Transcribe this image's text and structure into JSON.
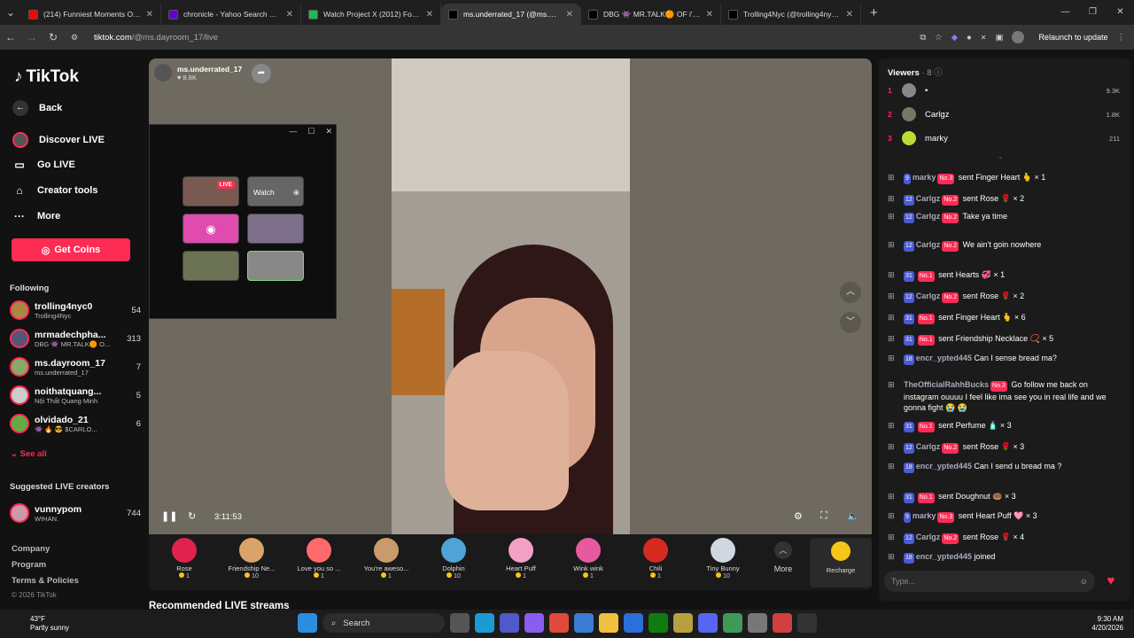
{
  "tabs": [
    {
      "title": "(214) Funniest Moments On Po...",
      "color": "#ff0000"
    },
    {
      "title": "chronicle - Yahoo Search Results",
      "color": "#6001d2"
    },
    {
      "title": "Watch Project X (2012) For Free",
      "color": "#1db954"
    },
    {
      "title": "ms.underrated_17 (@ms.da...",
      "color": "#000000",
      "active": true
    },
    {
      "title": "DBG 👾 MR.TALK🟠 OF i'y Di",
      "color": "#000000"
    },
    {
      "title": "Trolling4Nyc (@trolling4nyc...",
      "color": "#000000"
    }
  ],
  "address": {
    "host": "tiktok.com",
    "path": "/@ms.dayroom_17/live",
    "relaunch": "Relaunch to update"
  },
  "sidebar": {
    "brand": "TikTok",
    "back": "Back",
    "discover": "Discover LIVE",
    "golive": "Go LIVE",
    "creator": "Creator tools",
    "more": "More",
    "getcoins": "Get Coins",
    "following_title": "Following",
    "following": [
      {
        "name": "trolling4nyc0",
        "sub": "Trolling4Nyc",
        "count": "54"
      },
      {
        "name": "mrmadechpha...",
        "sub": "DBG 👾 MR.TALK🟠 O...",
        "count": "313"
      },
      {
        "name": "ms.dayroom_17",
        "sub": "ms.underrated_17",
        "count": "7"
      },
      {
        "name": "noithatquang...",
        "sub": "Nội Thất Quang Minh",
        "count": "5"
      },
      {
        "name": "olvidado_21",
        "sub": "👾 🔥 😎 $CARLO...",
        "count": "6"
      }
    ],
    "seeall": "See all",
    "suggested_title": "Suggested LIVE creators",
    "suggested": {
      "name": "vunnypom",
      "sub": "WIHAN.",
      "count": "744"
    },
    "footer": [
      "Company",
      "Program",
      "Terms & Policies"
    ],
    "copyright": "© 2026 TikTok"
  },
  "player": {
    "streamer": "ms.underrated_17",
    "likes": "♥ 8.8K",
    "time": "3:11:53",
    "popup": {
      "live": "LIVE",
      "watch": "Watch"
    }
  },
  "gifts": [
    {
      "name": "Rose",
      "price": "1",
      "color": "#e0234e"
    },
    {
      "name": "Friendship Ne...",
      "price": "10",
      "color": "#d9a36b"
    },
    {
      "name": "Love you so ...",
      "price": "1",
      "color": "#ff6a6a"
    },
    {
      "name": "You're aweso...",
      "price": "1",
      "color": "#c99a6b"
    },
    {
      "name": "Dolphin",
      "price": "10",
      "color": "#4fa3d6"
    },
    {
      "name": "Heart Puff",
      "price": "1",
      "color": "#f2a1c4"
    },
    {
      "name": "Wink wink",
      "price": "1",
      "color": "#e85aa0"
    },
    {
      "name": "Chili",
      "price": "1",
      "color": "#d62a1f"
    },
    {
      "name": "Tiny Bunny",
      "price": "10",
      "color": "#cfd8e0"
    }
  ],
  "gift_more": "More",
  "recharge": "Recharge",
  "recommended": "Recommended LIVE streams",
  "chat": {
    "viewers_title": "Viewers",
    "viewers_count": "· 8",
    "viewers": [
      {
        "rank": "1",
        "name": "•",
        "score": "9.3K"
      },
      {
        "rank": "2",
        "name": "Carlgz",
        "score": "1.8K"
      },
      {
        "rank": "3",
        "name": "marky",
        "score": "211"
      }
    ],
    "messages": [
      {
        "lvl": "9",
        "user": "marky",
        "rank": "No.3",
        "text": "sent Finger Heart 🫰 × 1"
      },
      {
        "lvl": "12",
        "user": "Carlgz",
        "rank": "No.2",
        "text": "sent Rose 🌹 × 2"
      },
      {
        "lvl": "12",
        "user": "Carlgz",
        "rank": "No.2",
        "text": "Take ya time"
      },
      {
        "lvl": "12",
        "user": "Carlgz",
        "rank": "No.2",
        "text": "We ain't goin nowhere"
      },
      {
        "lvl": "31",
        "user": "",
        "rank": "No.1",
        "text": "sent Hearts 💞 × 1"
      },
      {
        "lvl": "12",
        "user": "Carlgz",
        "rank": "No.2",
        "text": "sent Rose 🌹 × 2"
      },
      {
        "lvl": "31",
        "user": "",
        "rank": "No.1",
        "text": "sent Finger Heart 🫰 × 6"
      },
      {
        "lvl": "31",
        "user": "",
        "rank": "No.1",
        "text": "sent Friendship Necklace 📿 × 5"
      },
      {
        "lvl": "18",
        "user": "encr_ypted445",
        "rank": "",
        "text": "Can I sense bread ma?"
      },
      {
        "lvl": "",
        "user": "TheOfficialRahhBucks",
        "rank": "No.3",
        "text": "Go follow me back on instagram ouuuu I feel like ima see you in real life and we gonna fight 😭 😭"
      },
      {
        "lvl": "31",
        "user": "",
        "rank": "No.1",
        "text": "sent Perfume 🧴 × 3"
      },
      {
        "lvl": "12",
        "user": "Carlgz",
        "rank": "No.2",
        "text": "sent Rose 🌹 × 3"
      },
      {
        "lvl": "18",
        "user": "encr_ypted445",
        "rank": "",
        "text": "Can I send u bread ma ?"
      },
      {
        "lvl": "31",
        "user": "",
        "rank": "No.1",
        "text": "sent Doughnut 🍩 × 3"
      },
      {
        "lvl": "9",
        "user": "marky",
        "rank": "No.3",
        "text": "sent Heart Puff 🩷 × 3"
      },
      {
        "lvl": "12",
        "user": "Carlgz",
        "rank": "No.2",
        "text": "sent Rose 🌹 × 4"
      },
      {
        "lvl": "18",
        "user": "encr_ypted445",
        "rank": "",
        "text": "joined"
      }
    ],
    "placeholder": "Type..."
  },
  "taskbar": {
    "temp": "43°F",
    "cond": "Partly sunny",
    "search": "Search",
    "time": "9:30 AM",
    "date": "4/20/2026"
  }
}
